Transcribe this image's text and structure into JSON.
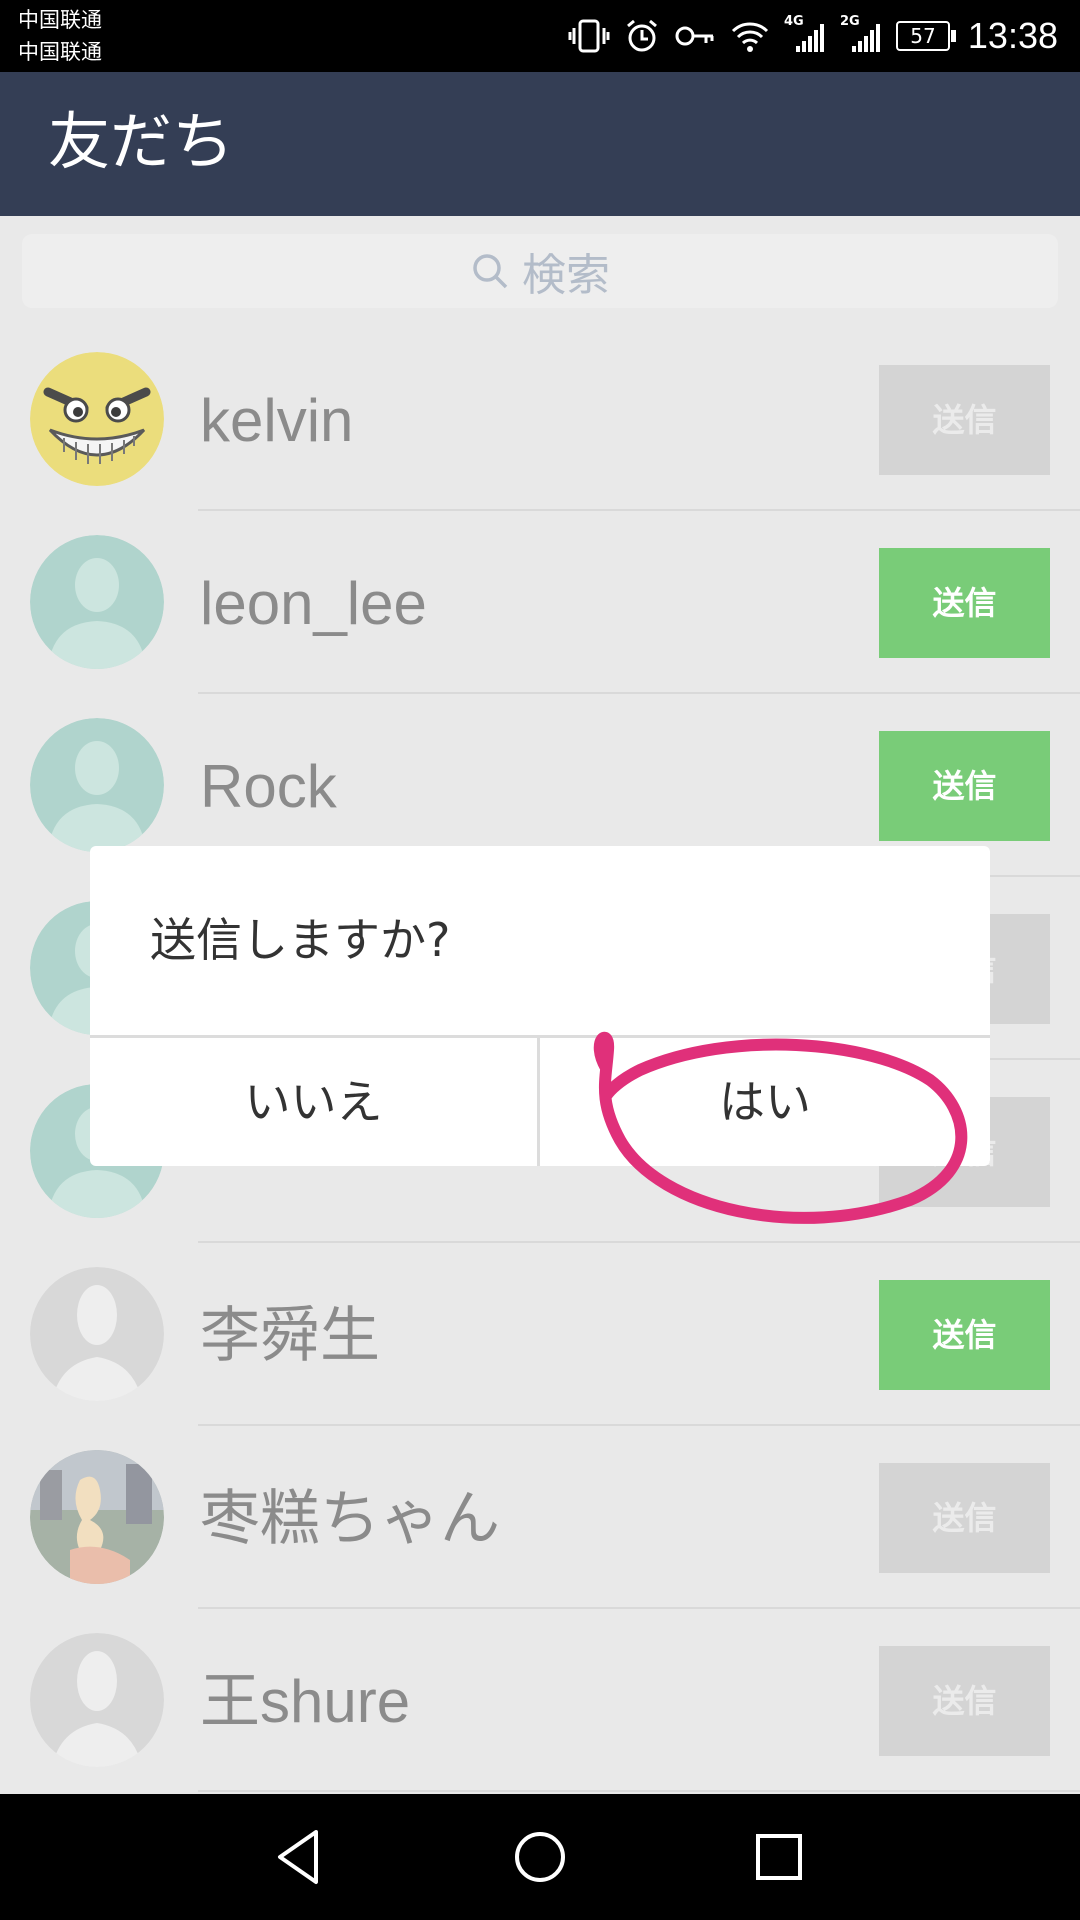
{
  "status_bar": {
    "carrier_1": "中国联通",
    "carrier_2": "中国联通",
    "network_1": "4G",
    "network_2": "2G",
    "battery": "57",
    "time": "13:38",
    "icons": [
      "vibrate-icon",
      "alarm-icon",
      "key-icon",
      "wifi-icon",
      "signal-4g-icon",
      "signal-2g-icon",
      "battery-icon"
    ]
  },
  "app_bar": {
    "title": "友だち"
  },
  "search": {
    "placeholder": "検索",
    "icon": "search-icon"
  },
  "contacts": [
    {
      "name": "kelvin",
      "send_label": "送信",
      "send_enabled": false,
      "avatar": "smiley-face"
    },
    {
      "name": "leon_lee",
      "send_label": "送信",
      "send_enabled": true,
      "avatar": "default-teal"
    },
    {
      "name": "Rock",
      "send_label": "送信",
      "send_enabled": true,
      "avatar": "default-teal"
    },
    {
      "name": "",
      "send_label": "送信",
      "send_enabled": false,
      "avatar": "default-teal"
    },
    {
      "name": "",
      "send_label": "送信",
      "send_enabled": false,
      "avatar": "default-teal"
    },
    {
      "name": "李舜生",
      "send_label": "送信",
      "send_enabled": true,
      "avatar": "default-gray"
    },
    {
      "name": "枣糕ちゃん",
      "send_label": "送信",
      "send_enabled": false,
      "avatar": "photo"
    },
    {
      "name": "王shure",
      "send_label": "送信",
      "send_enabled": false,
      "avatar": "default-gray"
    }
  ],
  "dialog": {
    "message": "送信しますか?",
    "cancel_label": "いいえ",
    "confirm_label": "はい"
  },
  "annotation": {
    "shape": "hand-drawn-circle",
    "color": "#e0307a",
    "target": "confirm-button"
  },
  "colors": {
    "app_bar": "#343e55",
    "send_enabled": "#67c566",
    "send_disabled": "#cfcfcf",
    "list_bg": "#e6e6e6"
  },
  "nav_bar": {
    "buttons": [
      "back-icon",
      "home-icon",
      "recents-icon"
    ]
  }
}
